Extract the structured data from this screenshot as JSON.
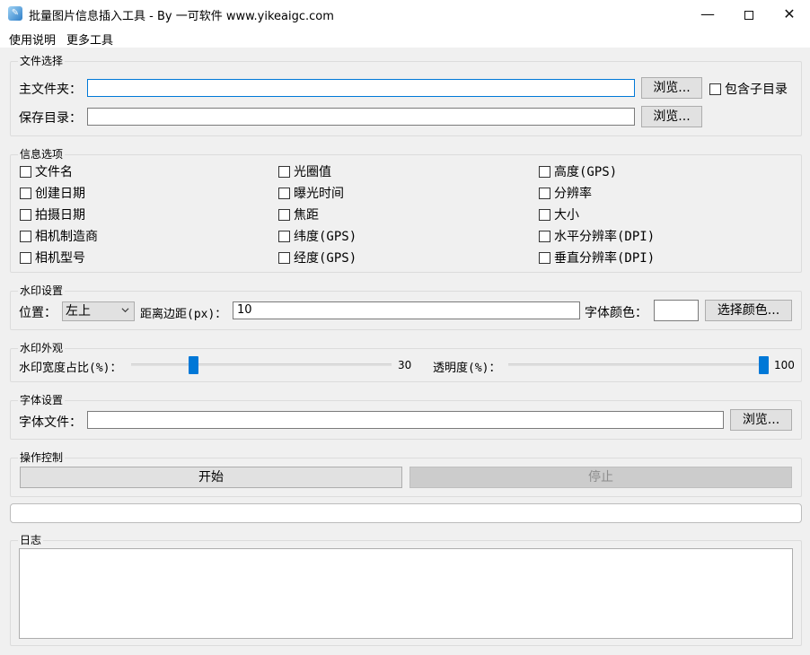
{
  "window": {
    "title": "批量图片信息插入工具 - By 一可软件 www.yikeaigc.com",
    "min_glyph": "—",
    "close_glyph": "✕"
  },
  "menu": {
    "items": [
      "使用说明",
      "更多工具"
    ]
  },
  "file_section": {
    "title": "文件选择",
    "main_folder_label": "主文件夹：",
    "main_folder_value": "",
    "browse_label": "浏览...",
    "include_subdirs_label": "包含子目录",
    "save_dir_label": "保存目录：",
    "save_dir_value": "",
    "browse2_label": "浏览..."
  },
  "info_section": {
    "title": "信息选项",
    "col1": [
      "文件名",
      "创建日期",
      "拍摄日期",
      "相机制造商",
      "相机型号"
    ],
    "col2": [
      "光圈值",
      "曝光时间",
      "焦距",
      "纬度(GPS)",
      "经度(GPS)"
    ],
    "col3": [
      "高度(GPS)",
      "分辨率",
      "大小",
      "水平分辨率(DPI)",
      "垂直分辨率(DPI)"
    ]
  },
  "watermark_section": {
    "title": "水印设置",
    "position_label": "位置：",
    "position_value": "左上",
    "margin_label": "距离边距(px)：",
    "margin_value": "10",
    "font_color_label": "字体颜色：",
    "font_color": "#ffffff",
    "choose_color_label": "选择颜色..."
  },
  "appearance_section": {
    "title": "水印外观",
    "width_ratio_label": "水印宽度占比(%)：",
    "width_ratio_value": "30",
    "width_ratio_fraction": 0.23,
    "opacity_label": "透明度(%)：",
    "opacity_value": "100",
    "opacity_fraction": 1.0
  },
  "font_section": {
    "title": "字体设置",
    "font_file_label": "字体文件：",
    "font_file_value": "",
    "browse_label": "浏览..."
  },
  "control_section": {
    "title": "操作控制",
    "start_label": "开始",
    "stop_label": "停止"
  },
  "log_section": {
    "title": "日志",
    "content": ""
  },
  "colors": {
    "accent": "#0078d7",
    "disabled_text": "#8d8d8d"
  }
}
